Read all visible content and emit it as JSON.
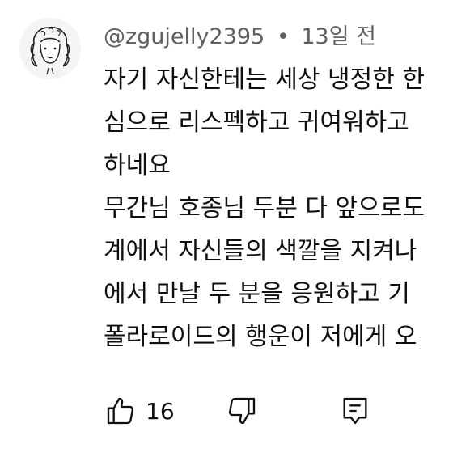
{
  "comment": {
    "author": "@zgujelly2395",
    "separator": "•",
    "time": "13일 전",
    "lines": [
      "자기 자신한테는 세상 냉정한 한",
      "심으로 리스펙하고 귀여워하고",
      "하네요",
      "무간님 호종님 두분 다 앞으로도",
      "계에서 자신들의 색깔을 지켜나",
      "에서 만날 두 분을 응원하고 기",
      "폴라로이드의 행운이 저에게 오"
    ],
    "like_count": "16"
  },
  "icons": {
    "avatar": "avatar-drawing",
    "like": "thumbs-up-icon",
    "dislike": "thumbs-down-icon",
    "reply": "reply-comment-icon"
  }
}
